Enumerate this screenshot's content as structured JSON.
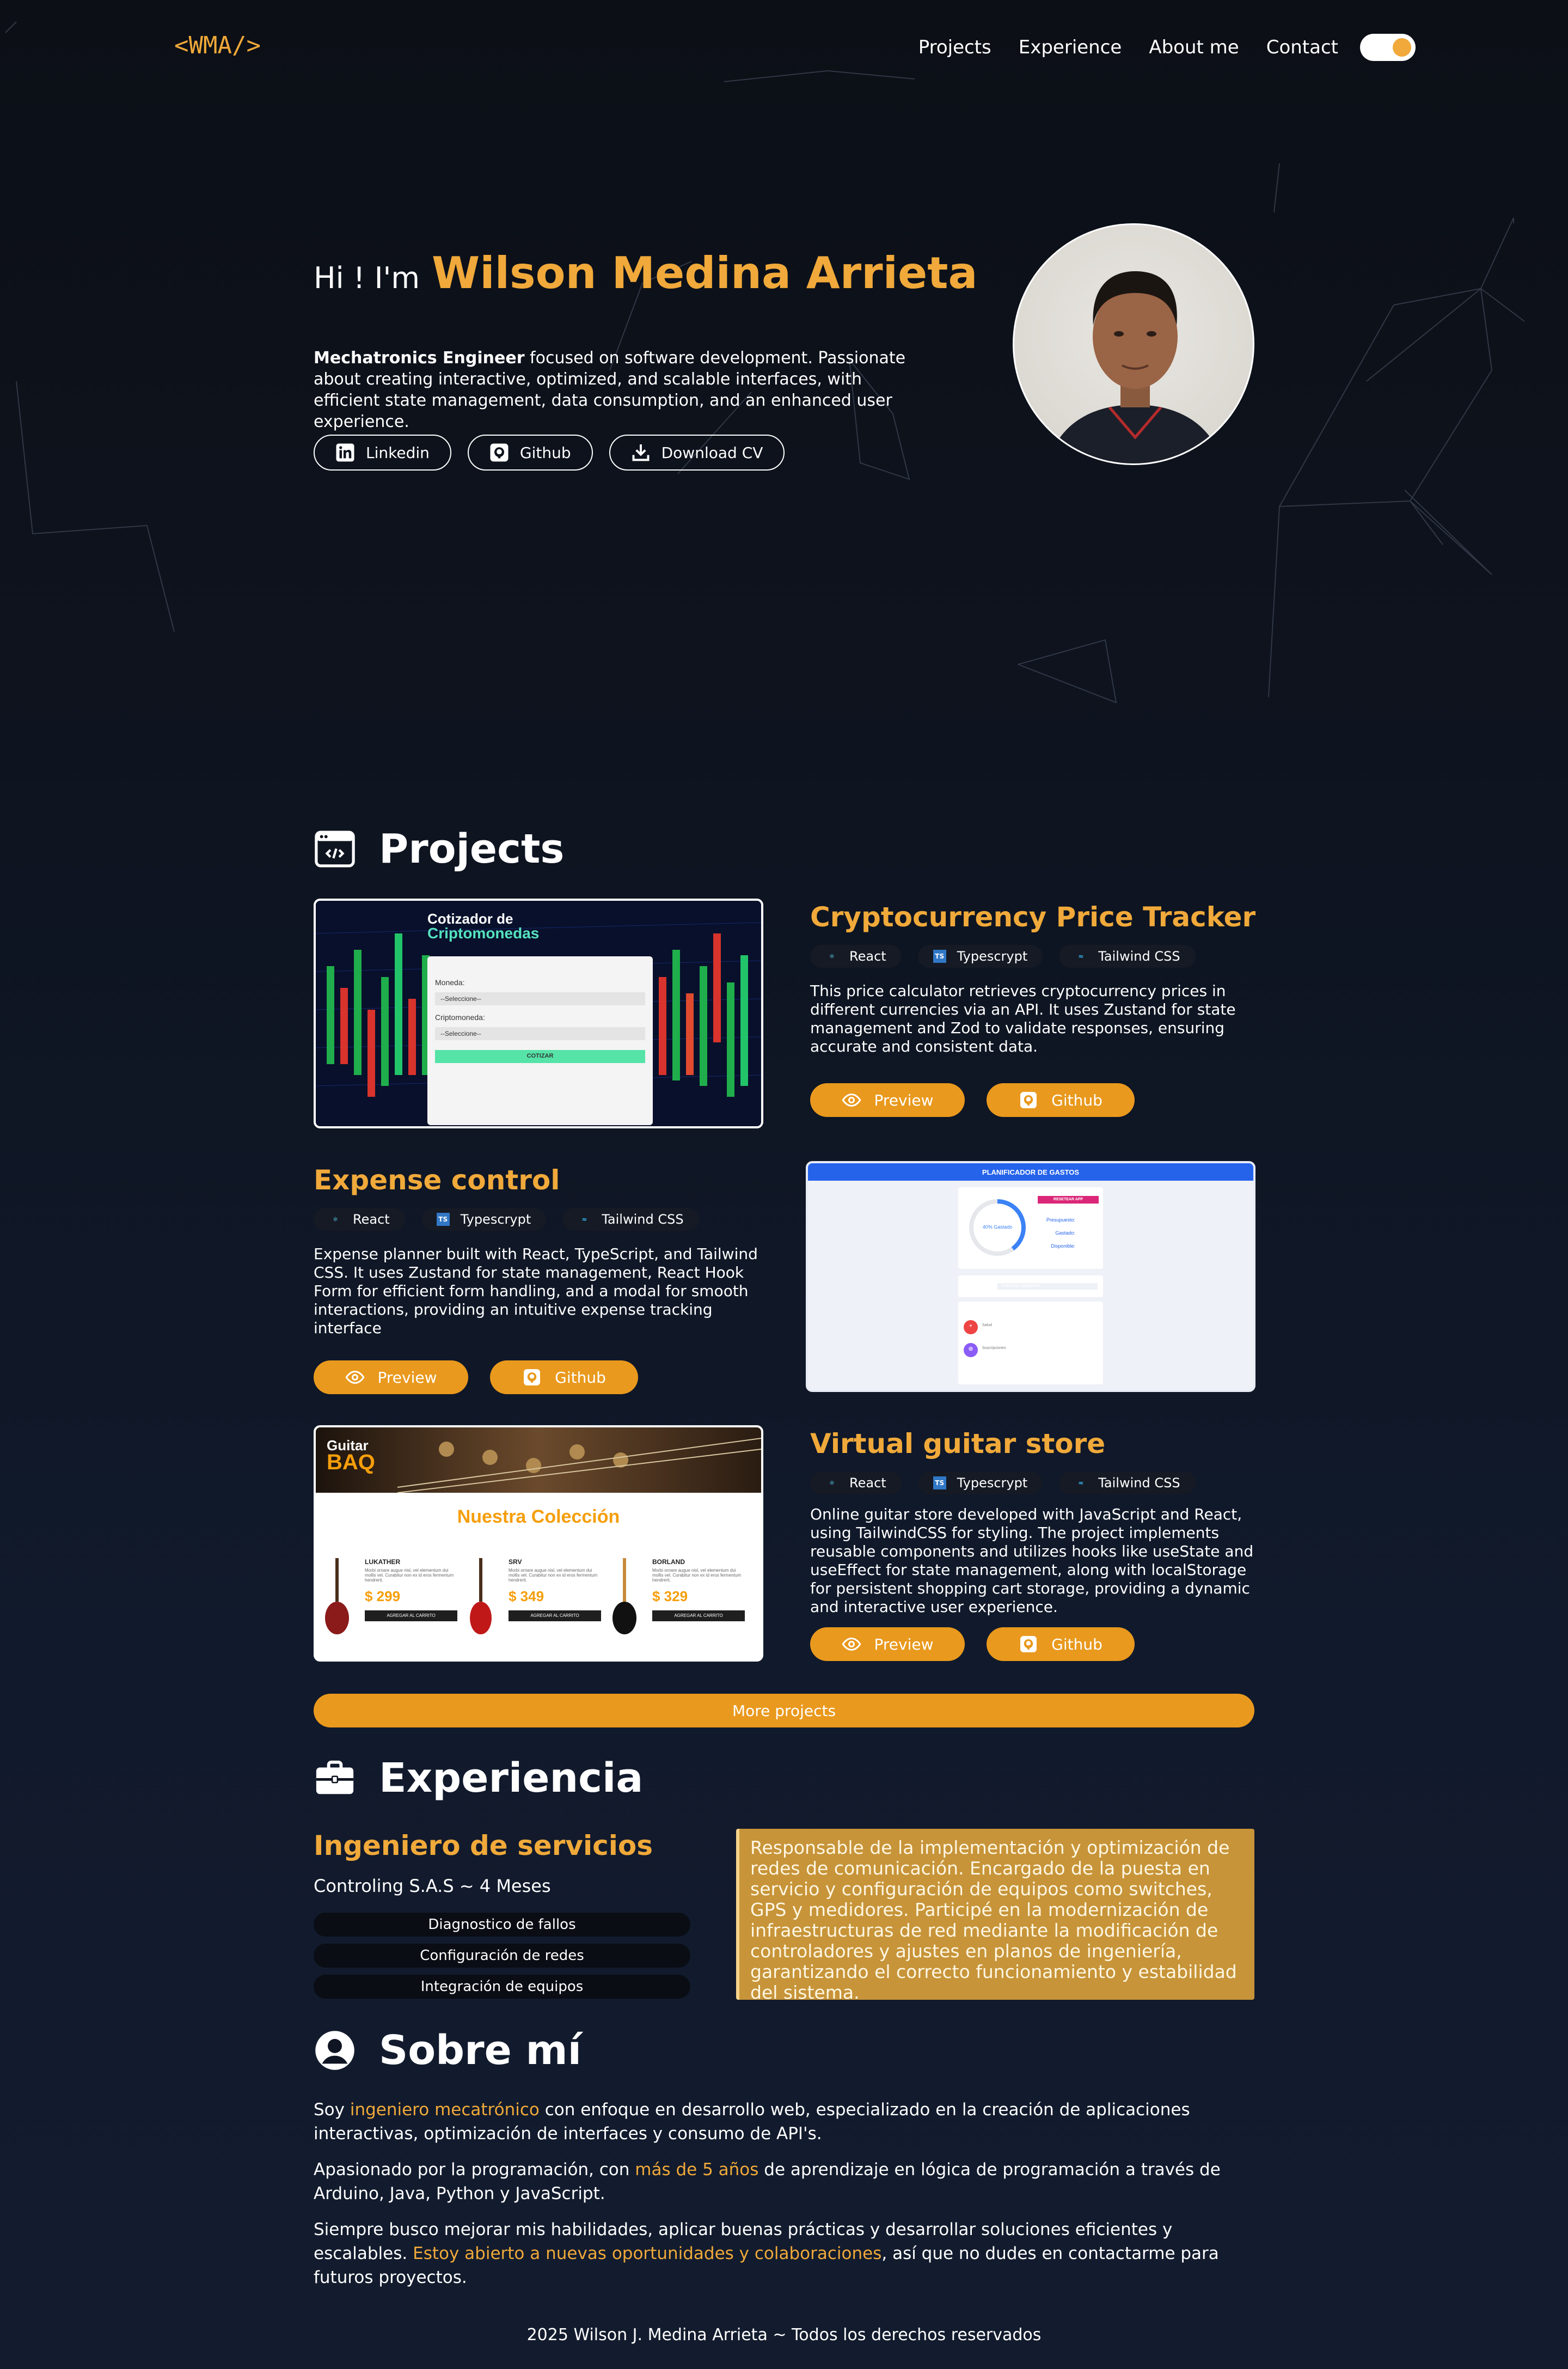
{
  "nav": {
    "logo": "<WMA/>",
    "links": [
      "Projects",
      "Experience",
      "About me",
      "Contact"
    ]
  },
  "hero": {
    "greeting": "Hi ! I'm",
    "name": "Wilson Medina Arrieta",
    "desc_bold": "Mechatronics Engineer",
    "desc_rest": " focused on software development. Passionate about creating interactive, optimized, and scalable interfaces, with efficient state management, data consumption, and an enhanced user experience.",
    "buttons": [
      "Linkedin",
      "Github",
      "Download CV"
    ]
  },
  "projects": {
    "title": "Projects",
    "items": [
      {
        "title": "Cryptocurrency Price Tracker",
        "tags": [
          "React",
          "Typescrypt",
          "Tailwind CSS"
        ],
        "desc": "This price calculator retrieves cryptocurrency prices in different currencies via an API. It uses Zustand for state management and Zod to validate responses, ensuring accurate and consistent data.",
        "preview": "Preview",
        "github": "Github",
        "shot": {
          "title1": "Cotizador de",
          "title2": "Criptomonedas",
          "label1": "Moneda:",
          "select1": "--Seleccione--",
          "label2": "Criptomoneda:",
          "select2": "--Seleccione--",
          "button": "COTIZAR"
        }
      },
      {
        "title": "Expense control",
        "tags": [
          "React",
          "Typescrypt",
          "Tailwind CSS"
        ],
        "desc": "Expense planner built with React, TypeScript, and Tailwind CSS. It uses Zustand for state management, React Hook Form for efficient form handling, and a modal for smooth interactions, providing an intuitive expense tracking interface",
        "preview": "Preview",
        "github": "Github",
        "shot": {
          "header": "PLANIFICADOR DE GASTOS",
          "reset": "RESETEAR APP",
          "ring_label": "40% Gastado",
          "row1_label": "Presupuesto:",
          "row1_value": "$500.00",
          "row2_label": "Gastado:",
          "row2_value": "$200.00",
          "row3_label": "Disponible:",
          "row3_value": "$300.00",
          "filter_label": "Filtrar gastos:",
          "filter_value": "Todas las categorias",
          "list_title": "Listado de gastos",
          "item1_cat": "Salud",
          "item1_name": "Medico",
          "item1_value": "$100.00",
          "item2_cat": "Suscripciones",
          "item2_name": "Netflix",
          "item2_value": "$30.00"
        }
      },
      {
        "title": "Virtual guitar store",
        "tags": [
          "React",
          "Typescrypt",
          "Tailwind CSS"
        ],
        "desc": "Online guitar store developed with JavaScript and React, using TailwindCSS for styling. The project implements reusable components and utilizes hooks like useState and useEffect for state management, along with localStorage for persistent shopping cart storage, providing a dynamic and interactive user experience.",
        "preview": "Preview",
        "github": "Github",
        "shot": {
          "logo1": "Guitar",
          "logo2": "BAQ",
          "heading": "Nuestra Colección",
          "guitars": [
            {
              "name": "LUKATHER",
              "price": "$ 299"
            },
            {
              "name": "SRV",
              "price": "$ 349"
            },
            {
              "name": "BORLAND",
              "price": "$ 329"
            }
          ],
          "guitar_desc": "Morbi ornare augue nisl, vel elementum dui mollis vel. Curabitur non ex id eros fermentum hendrerit.",
          "add_button": "AGREGAR AL CARRITO"
        }
      }
    ],
    "more": "More projects"
  },
  "experience": {
    "title": "Experiencia",
    "role": "Ingeniero de servicios",
    "company": "Controling S.A.S ~ 4 Meses",
    "tags": [
      "Diagnostico de fallos",
      "Configuración de redes",
      "Integración de equipos"
    ],
    "desc": "Responsable de la implementación y optimización de redes de comunicación. Encargado de la puesta en servicio y configuración de equipos como switches, GPS y medidores. Participé en la modernización de infraestructuras de red mediante la modificación de controladores y ajustes en planos de ingeniería, garantizando el correcto funcionamiento y estabilidad del sistema."
  },
  "about": {
    "title": "Sobre mí",
    "p1_a": "Soy ",
    "p1_hl": "ingeniero mecatrónico",
    "p1_b": " con enfoque en desarrollo web, especializado en la creación de aplicaciones interactivas, optimización de interfaces y consumo de API's.",
    "p2_a": "Apasionado por la programación, con ",
    "p2_hl": "más de 5 años",
    "p2_b": " de aprendizaje en lógica de programación a través de Arduino, Java, Python y JavaScript.",
    "p3_a": "Siempre busco mejorar mis habilidades, aplicar buenas prácticas y desarrollar soluciones eficientes y escalables. ",
    "p3_hl": "Estoy abierto a nuevas oportunidades y colaboraciones",
    "p3_b": ", así que no dudes en contactarme para futuros proyectos."
  },
  "footer": "2025 Wilson J. Medina Arrieta ~ Todos los derechos reservados",
  "colors": {
    "accent": "#f0a93a",
    "button": "#e9991d",
    "card": "#c79439"
  },
  "icons": [
    "window-code-icon",
    "briefcase-icon",
    "user-circle-icon",
    "linkedin-icon",
    "github-icon",
    "download-icon",
    "eye-icon",
    "react-icon",
    "typescript-icon",
    "tailwind-icon"
  ]
}
